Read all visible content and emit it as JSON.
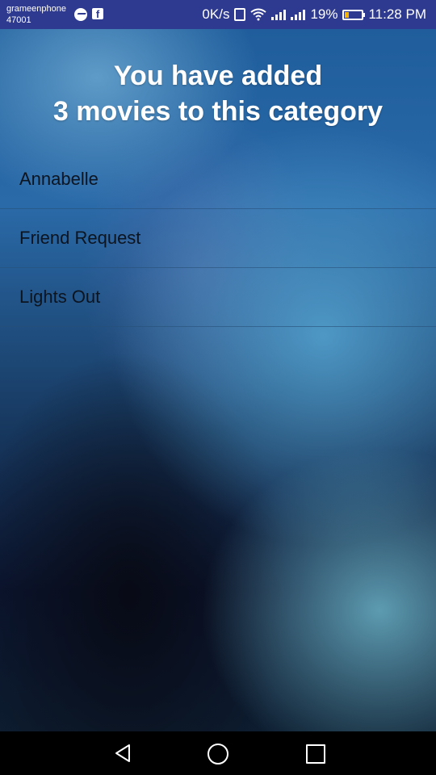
{
  "status_bar": {
    "carrier_name": "grameenphone",
    "carrier_code": "47001",
    "notification_icons": [
      "messenger-icon",
      "facebook-icon"
    ],
    "network_speed": "0K/s",
    "battery_percent": "19%",
    "battery_level": 0.19,
    "time": "11:28 PM",
    "bar_color": "#2e3a8f",
    "battery_color": "#f5b400"
  },
  "heading": {
    "line1": "You have added",
    "line2": "3 movies to this category"
  },
  "movies": [
    {
      "title": "Annabelle"
    },
    {
      "title": "Friend Request"
    },
    {
      "title": "Lights Out"
    }
  ],
  "nav_bar": {
    "icons": [
      "back-icon",
      "home-icon",
      "recents-icon"
    ]
  }
}
